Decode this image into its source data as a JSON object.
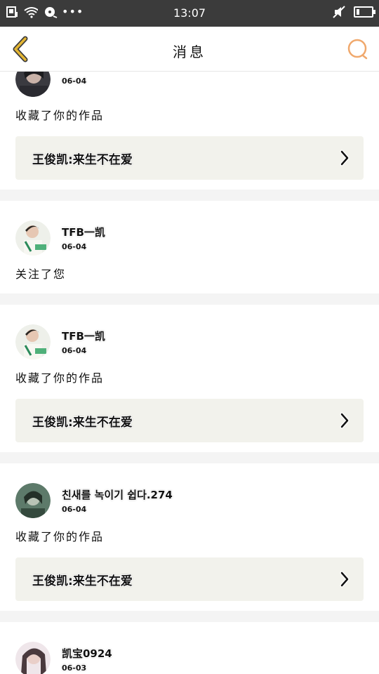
{
  "status_bar": {
    "time": "13:07",
    "dots": "•••",
    "battery_level": 0.2,
    "icons": [
      "storage-icon",
      "wifi-icon",
      "hotspot-icon",
      "more-icon",
      "mute-icon",
      "battery-icon"
    ]
  },
  "header": {
    "title": "消息",
    "back_icon": "chevron-left-icon",
    "search_icon": "search-icon"
  },
  "colors": {
    "accent_back": "#e3b533",
    "accent_search": "#f0a86c",
    "card_bg": "#ffffff",
    "link_bg": "#f2f2ec",
    "page_bg": "#f4f4f4"
  },
  "messages": [
    {
      "user": "",
      "date": "06-04",
      "action": "收藏了你的作品",
      "work": "王俊凯:来生不在爱"
    },
    {
      "user": "TFB一凯",
      "date": "06-04",
      "action": "关注了您",
      "work": ""
    },
    {
      "user": "TFB一凯",
      "date": "06-04",
      "action": "收藏了你的作品",
      "work": "王俊凯:来生不在爱"
    },
    {
      "user": "친새를 녹이기 쉽다.274",
      "date": "06-04",
      "action": "收藏了你的作品",
      "work": "王俊凯:来生不在爱"
    },
    {
      "user": "凯宝0924",
      "date": "06-03",
      "action": "",
      "work": ""
    }
  ]
}
